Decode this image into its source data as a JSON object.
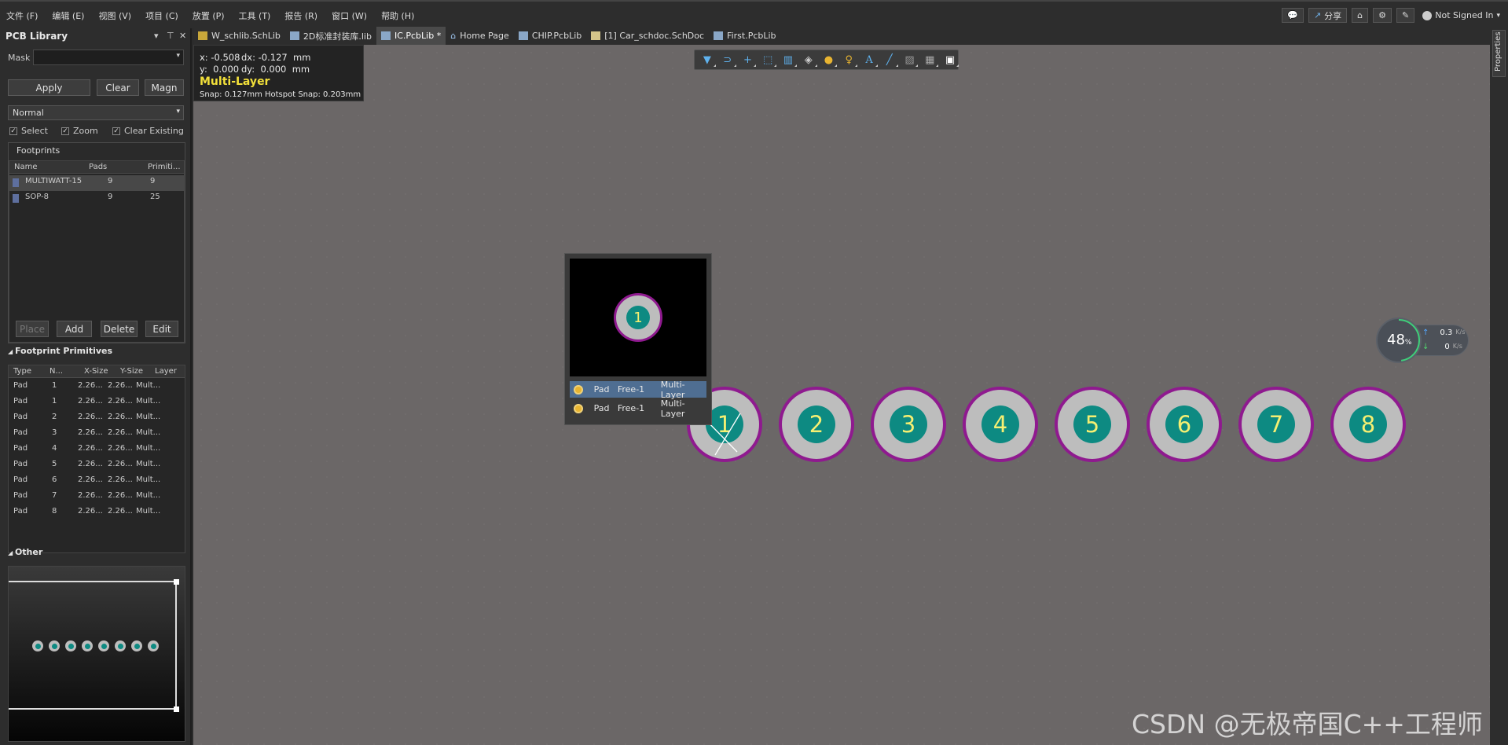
{
  "menubar": {
    "items": [
      "文件 (F)",
      "编辑 (E)",
      "视图 (V)",
      "项目 (C)",
      "放置 (P)",
      "工具 (T)",
      "报告 (R)",
      "窗口 (W)",
      "帮助 (H)"
    ],
    "share_label": "分享",
    "user_label": "Not Signed In"
  },
  "panel": {
    "title": "PCB Library",
    "mask_label": "Mask",
    "mask_value": "",
    "apply_label": "Apply",
    "clear_label": "Clear",
    "magnify_label": "Magn",
    "mode_value": "Normal",
    "select_label": "Select",
    "zoom_label": "Zoom",
    "clear_existing_label": "Clear Existing",
    "footprints_title": "Footprints",
    "footprint_columns": [
      "Name",
      "Pads",
      "Primiti..."
    ],
    "footprints": [
      {
        "name": "MULTIWATT-15",
        "pads": "9",
        "primitives": "9"
      },
      {
        "name": "SOP-8",
        "pads": "9",
        "primitives": "25"
      }
    ],
    "place_label": "Place",
    "add_label": "Add",
    "delete_label": "Delete",
    "edit_label": "Edit",
    "primitives_title": "Footprint Primitives",
    "primitive_columns": [
      "Type",
      "N...",
      "X-Size",
      "Y-Size",
      "Layer"
    ],
    "primitives": [
      {
        "type": "Pad",
        "n": "1",
        "x": "2.26...",
        "y": "2.26...",
        "layer": "Mult..."
      },
      {
        "type": "Pad",
        "n": "1",
        "x": "2.26...",
        "y": "2.26...",
        "layer": "Mult..."
      },
      {
        "type": "Pad",
        "n": "2",
        "x": "2.26...",
        "y": "2.26...",
        "layer": "Mult..."
      },
      {
        "type": "Pad",
        "n": "3",
        "x": "2.26...",
        "y": "2.26...",
        "layer": "Mult..."
      },
      {
        "type": "Pad",
        "n": "4",
        "x": "2.26...",
        "y": "2.26...",
        "layer": "Mult..."
      },
      {
        "type": "Pad",
        "n": "5",
        "x": "2.26...",
        "y": "2.26...",
        "layer": "Mult..."
      },
      {
        "type": "Pad",
        "n": "6",
        "x": "2.26...",
        "y": "2.26...",
        "layer": "Mult..."
      },
      {
        "type": "Pad",
        "n": "7",
        "x": "2.26...",
        "y": "2.26...",
        "layer": "Mult..."
      },
      {
        "type": "Pad",
        "n": "8",
        "x": "2.26...",
        "y": "2.26...",
        "layer": "Mult..."
      }
    ],
    "other_title": "Other"
  },
  "tabs": [
    {
      "label": "W_schlib.SchLib",
      "active": false
    },
    {
      "label": "2D标准封装库.lib",
      "active": false
    },
    {
      "label": "IC.PcbLib *",
      "active": true
    },
    {
      "label": "Home Page",
      "active": false
    },
    {
      "label": "CHIP.PcbLib",
      "active": false
    },
    {
      "label": "[1] Car_schdoc.SchDoc",
      "active": false
    },
    {
      "label": "First.PcbLib",
      "active": false
    }
  ],
  "properties_tab": "Properties",
  "hud": {
    "x": "x: -0.508",
    "dx": "dx: -0.127  mm",
    "y": "y:  0.000",
    "dy": "dy:  0.000  mm",
    "layer": "Multi-Layer",
    "snap": "Snap: 0.127mm Hotspot Snap: 0.203mm"
  },
  "pads": [
    "1",
    "2",
    "3",
    "4",
    "5",
    "6",
    "7",
    "8"
  ],
  "popup": {
    "preview_pad": "1",
    "rows": [
      {
        "type": "Pad",
        "net": "Free-1",
        "layer": "Multi-Layer",
        "selected": true
      },
      {
        "type": "Pad",
        "net": "Free-1",
        "layer": "Multi-Layer",
        "selected": false
      }
    ]
  },
  "speed": {
    "percent": "48",
    "percent_unit": "%",
    "up": "0.3",
    "down": "0",
    "unit": "K/s"
  },
  "watermark": "CSDN @无极帝国C++工程师",
  "colors": {
    "pad_ring": "#8f1a8f",
    "pad_hole": "#0d8a82",
    "pad_number": "#f5ef72",
    "hud_layer": "#f2e03a"
  }
}
